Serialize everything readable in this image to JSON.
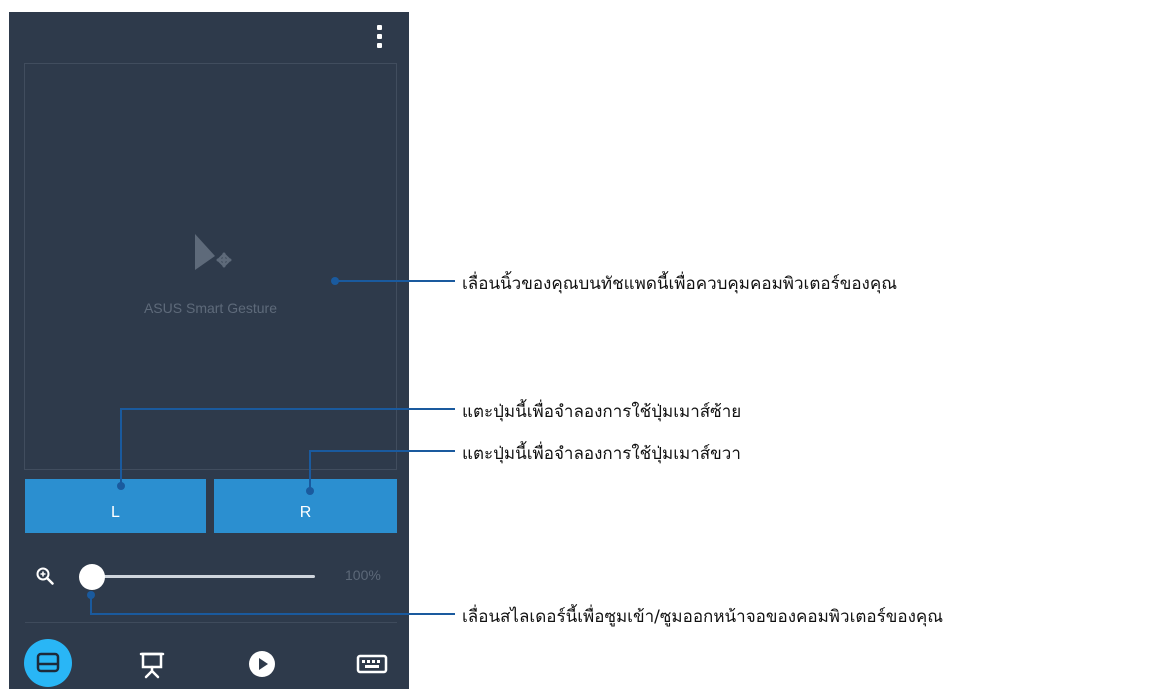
{
  "app": {
    "menu_icon": "more-vert-icon",
    "touchpad": {
      "icon": "pointer-move-icon",
      "label": "ASUS Smart Gesture"
    },
    "buttons": {
      "left": "L",
      "right": "R"
    },
    "zoom": {
      "icon": "zoom-in-icon",
      "value_label": "100%",
      "slider_level": 0.0
    },
    "nav": [
      {
        "name": "touchpad",
        "icon": "touchpad-icon",
        "active": true
      },
      {
        "name": "presentation",
        "icon": "presentation-icon",
        "active": false
      },
      {
        "name": "media",
        "icon": "play-icon",
        "active": false
      },
      {
        "name": "keyboard",
        "icon": "keyboard-icon",
        "active": false
      }
    ]
  },
  "callouts": {
    "touchpad": "เลื่อนนิ้วของคุณบนทัชแพดนี้เพื่อควบคุมคอมพิวเตอร์ของคุณ",
    "left_button": "แตะปุ่มนี้เพื่อจำลองการใช้ปุ่มเมาส์ซ้าย",
    "right_button": "แตะปุ่มนี้เพื่อจำลองการใช้ปุ่มเมาส์ขวา",
    "slider": "เลื่อนสไลเดอร์นี้เพื่อซูมเข้า/ซูมออกหน้าจอของคอมพิวเตอร์ของคุณ"
  },
  "colors": {
    "panel": "#2e3a4b",
    "button": "#2b8fd0",
    "nav_active": "#29b6f6",
    "callout_line": "#1a5a9e"
  }
}
